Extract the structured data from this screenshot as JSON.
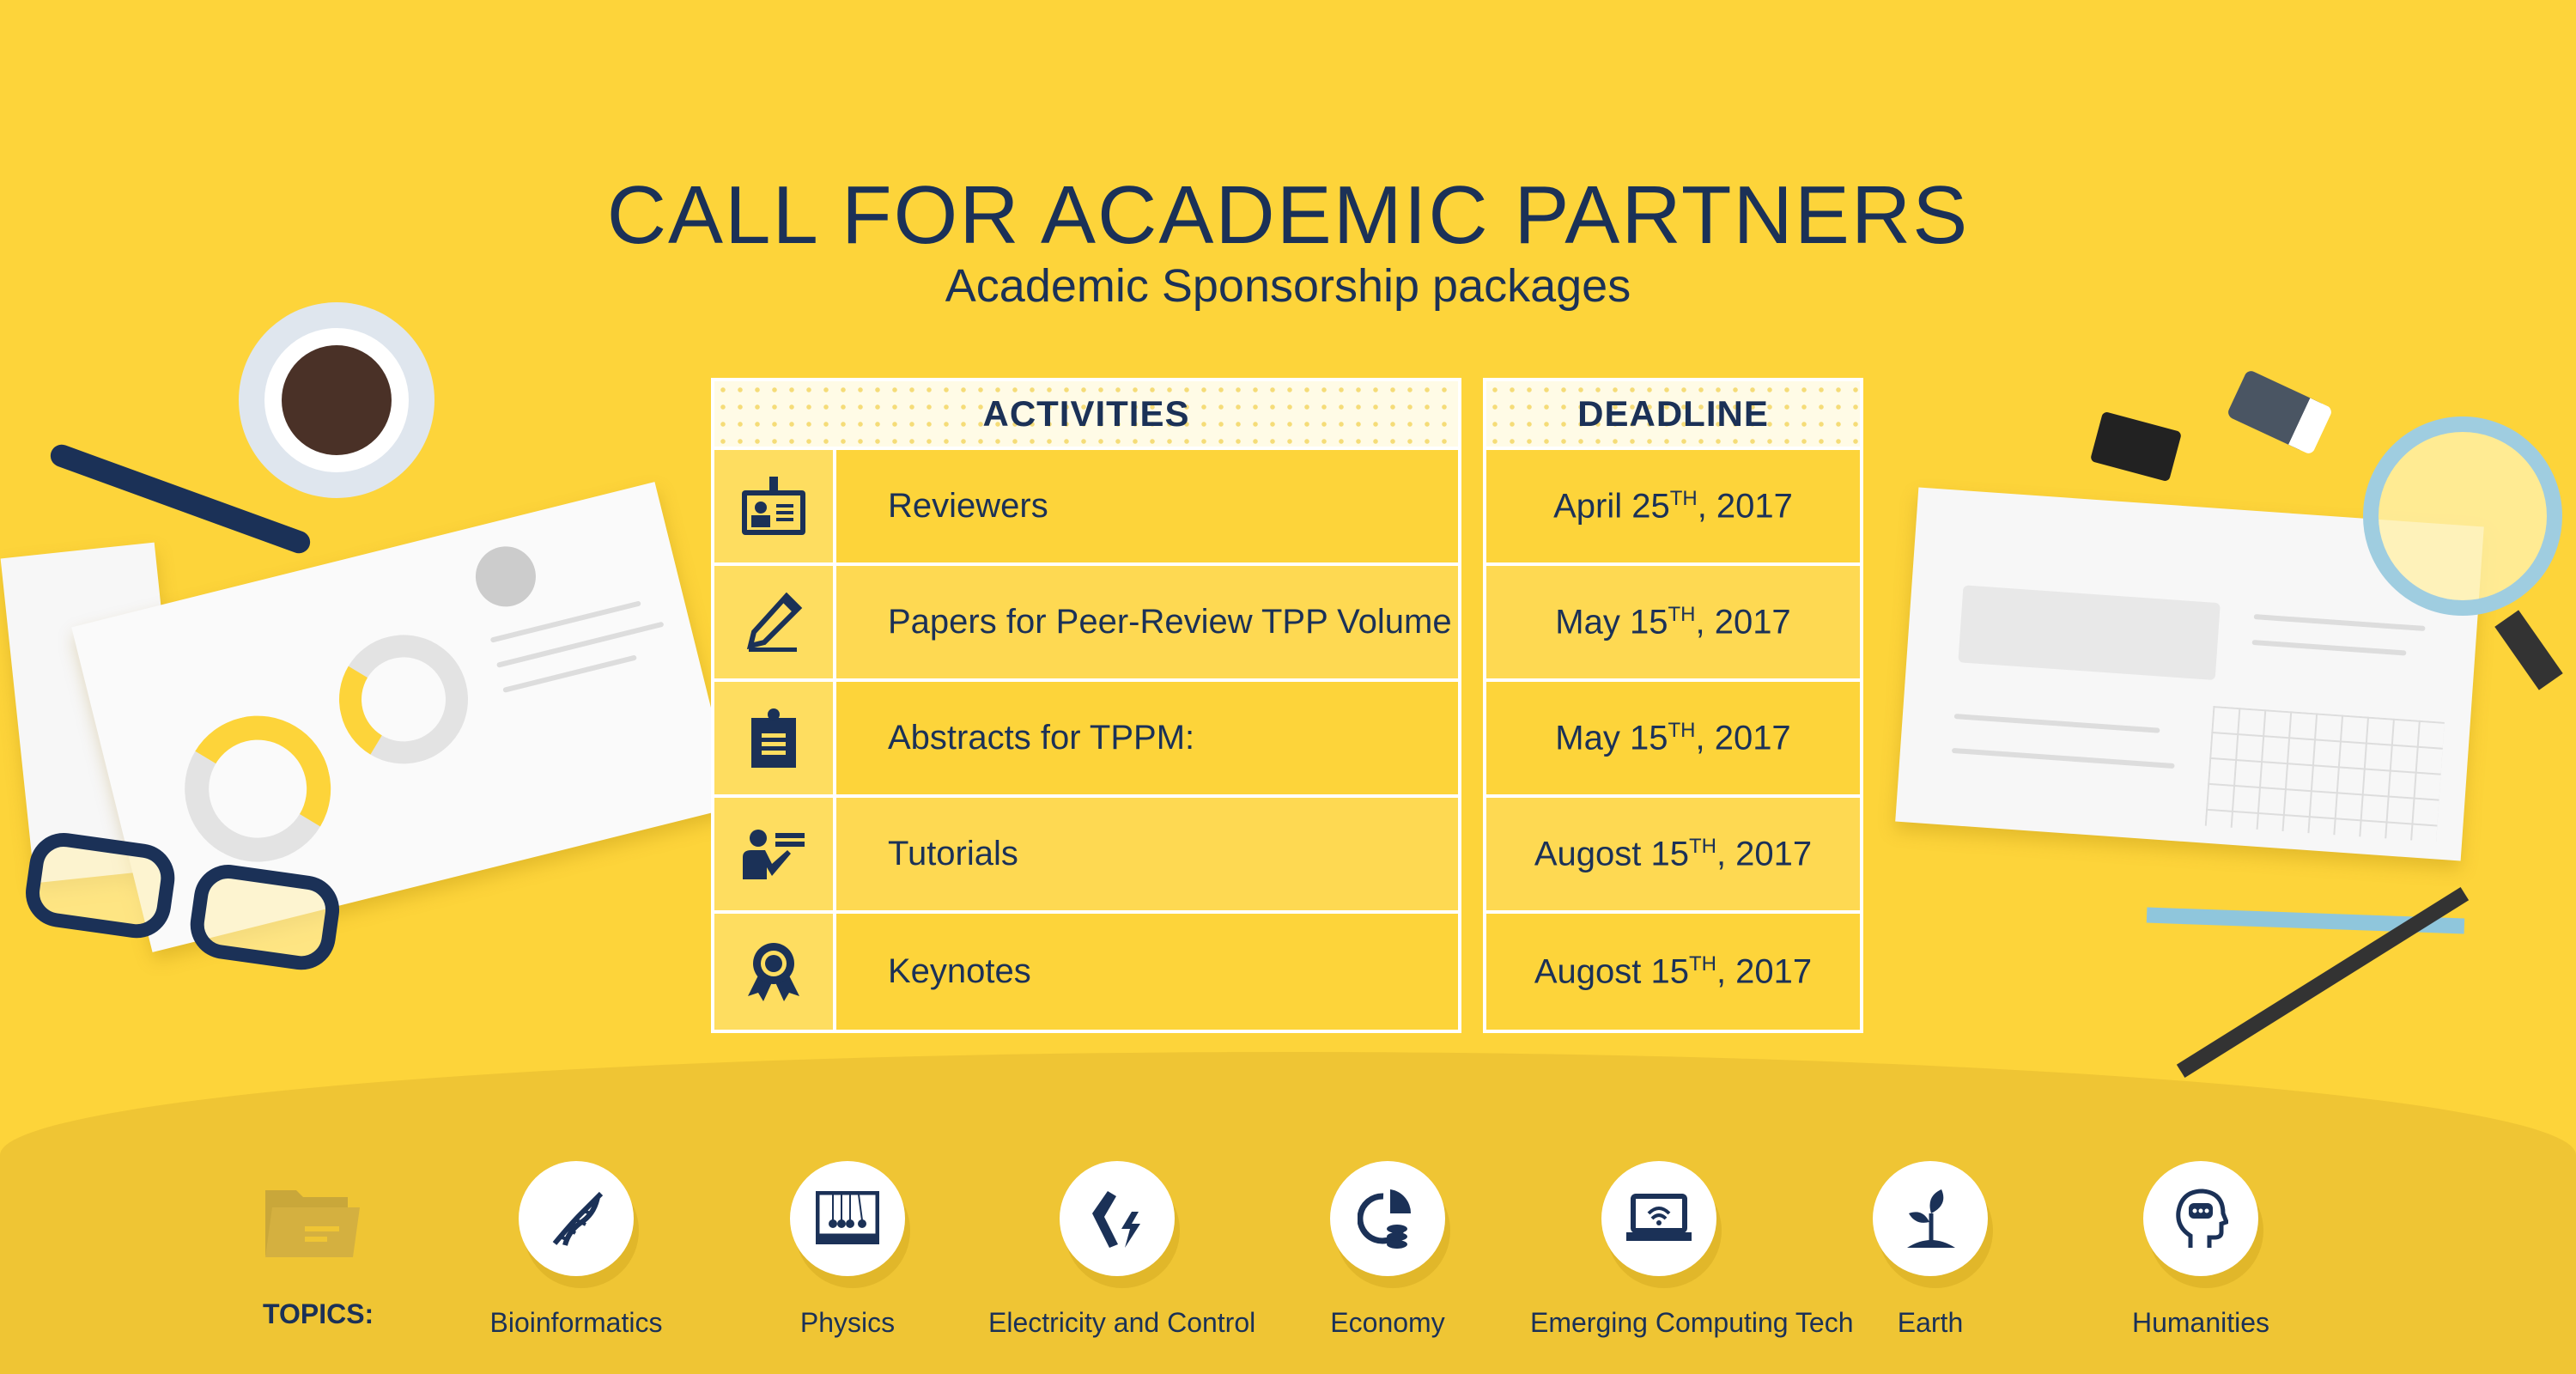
{
  "header": {
    "title": "CALL FOR ACADEMIC PARTNERS",
    "subtitle": "Academic Sponsorship packages"
  },
  "activities_table": {
    "header": "ACTIVITIES",
    "rows": [
      {
        "icon": "id-badge-icon",
        "label": "Reviewers"
      },
      {
        "icon": "pencil-icon",
        "label": "Papers for Peer-Review TPP Volume"
      },
      {
        "icon": "clipboard-icon",
        "label": "Abstracts for TPPM:"
      },
      {
        "icon": "presenter-icon",
        "label": "Tutorials"
      },
      {
        "icon": "award-ribbon-icon",
        "label": "Keynotes"
      }
    ]
  },
  "deadline_table": {
    "header": "DEADLINE",
    "rows": [
      {
        "pre": "April 25",
        "sup": "TH",
        "post": ", 2017"
      },
      {
        "pre": "May 15",
        "sup": "TH",
        "post": ", 2017"
      },
      {
        "pre": "May 15",
        "sup": "TH",
        "post": ", 2017"
      },
      {
        "pre": "Augost 15",
        "sup": "TH",
        "post": ", 2017"
      },
      {
        "pre": "Augost 15",
        "sup": "TH",
        "post": ", 2017"
      }
    ]
  },
  "topics": {
    "label": "TOPICS:",
    "items": [
      {
        "label": "Bioinformatics",
        "icon": "dna-icon"
      },
      {
        "label": "Physics",
        "icon": "newtons-cradle-icon"
      },
      {
        "label": "Electricity and Control",
        "icon": "robot-arm-icon"
      },
      {
        "label": "Economy",
        "icon": "pie-chart-coins-icon"
      },
      {
        "label": "Emerging Computing Tech",
        "icon": "laptop-wifi-icon"
      },
      {
        "label": "Earth",
        "icon": "sprout-icon"
      },
      {
        "label": "Humanities",
        "icon": "head-speech-icon"
      }
    ]
  },
  "colors": {
    "background": "#fdd43a",
    "band": "#efc534",
    "navy": "#1b3157",
    "white": "#ffffff"
  }
}
